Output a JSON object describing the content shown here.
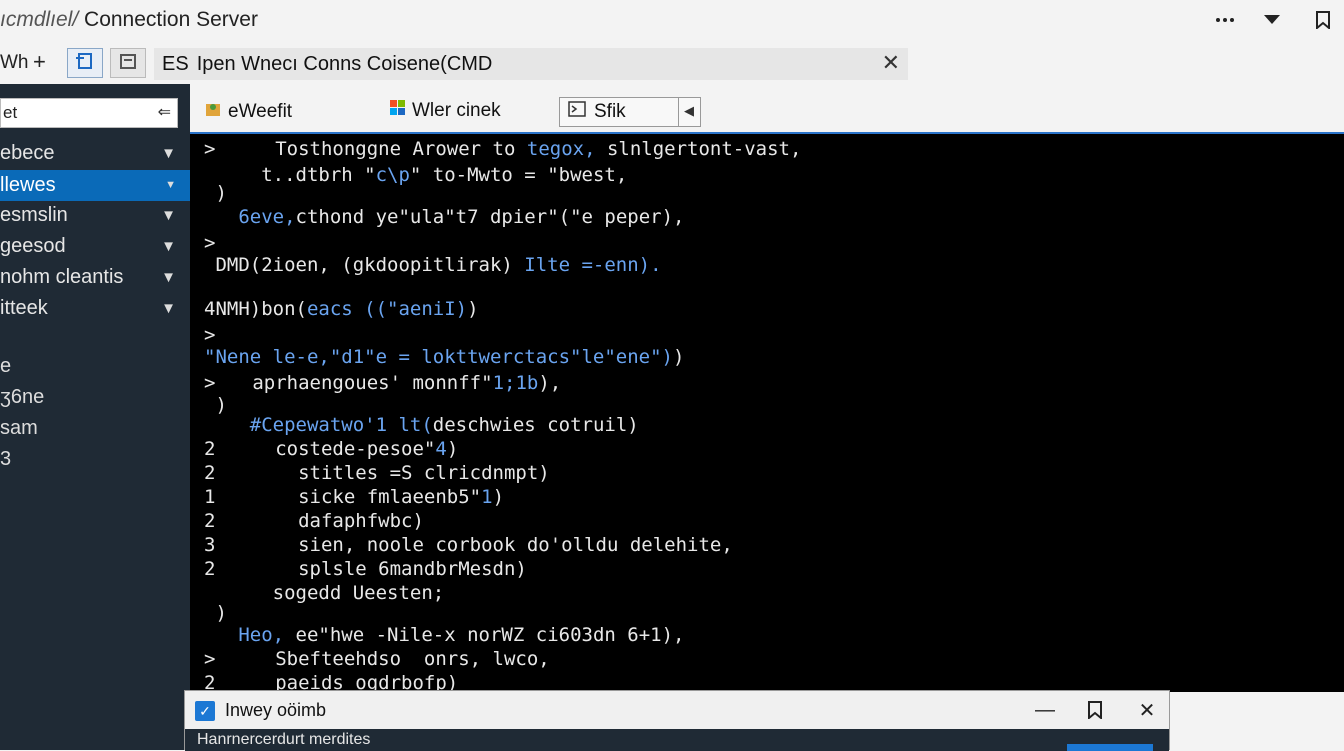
{
  "titlebar": {
    "app": "ıcmdlıel/",
    "title": "Connection Server",
    "more_icon": "more-dots-icon",
    "dropdown_icon": "triangle-down-icon",
    "pin_icon": "bookmark-icon"
  },
  "toolbar": {
    "window_label": "Wh",
    "add_label": "+",
    "address": "Ipen Wnecı  Conns Coisene(CMD",
    "address_prefix": "ES",
    "close_label": "✕"
  },
  "sidebar": {
    "search_value": "et",
    "search_arrow": "⇐",
    "items": [
      {
        "label": "ebece",
        "active": false
      },
      {
        "label": "llewes",
        "active": true
      },
      {
        "label": "esmslin",
        "active": false
      },
      {
        "label": "geesod",
        "active": false
      },
      {
        "label": "nohm cleantis",
        "active": false
      },
      {
        "label": "itteek",
        "active": false
      }
    ],
    "plain": [
      "e",
      "ӡ6ne",
      "sam",
      "3"
    ]
  },
  "inner_tabs": [
    {
      "label": "eWeefit",
      "icon": "package-icon"
    },
    {
      "label": "Wler cinek",
      "icon": "windows-icon"
    },
    {
      "label": "Sfik",
      "icon": "terminal-icon"
    }
  ],
  "terminal": {
    "lines": [
      {
        "prefix": ">",
        "text": "    Tosthonggne Arower to ",
        "blue": "tegox,",
        "rest": " slnlgertont-vast,"
      },
      {
        "prefix": "",
        "text": "     t..dtbrh \"",
        "blue": "c\\p",
        "rest": "\" to-Mwto = \"bwest,"
      },
      {
        "prefix": " )",
        "text": "",
        "blue": "",
        "rest": ""
      },
      {
        "prefix": "",
        "text": "   ",
        "blue": "6eve,",
        "rest": "cthond ye\"ula\"t7 dpier\"(\"e peper),"
      },
      {
        "prefix": ">",
        "text": "",
        "blue": "",
        "rest": ""
      },
      {
        "prefix": "",
        "text": " DMD(2ioen, (gkdoopitlirak) ",
        "blue": "Ilte =-enn).",
        "rest": ""
      },
      {
        "prefix": "",
        "text": "4NMH)bon(",
        "blue": "eacs ((\"aeniI)",
        "rest": ")"
      },
      {
        "prefix": ">",
        "text": "",
        "blue": "",
        "rest": ""
      },
      {
        "prefix": "",
        "text": "",
        "blue": "\"Nene le-e,\"d1\"e = lokttwerctacs\"le\"ene\")",
        "rest": ")"
      },
      {
        "prefix": ">",
        "text": "  aprhaengoues' monnff\"",
        "blue": "1;1b",
        "rest": "),"
      },
      {
        "prefix": " )",
        "text": "",
        "blue": "",
        "rest": ""
      },
      {
        "prefix": "",
        "text": "    ",
        "blue": "#Cepewatwo'1 lt(",
        "rest": "deschwies cotruil)"
      },
      {
        "prefix": "2",
        "text": "    costede-pesoe\"",
        "blue": "4",
        "rest": ")"
      },
      {
        "prefix": "2",
        "text": "      stitles =S clricdnmpt)",
        "blue": "",
        "rest": ""
      },
      {
        "prefix": "1",
        "text": "      sicke fmlaeenb5\"",
        "blue": "1",
        "rest": ")"
      },
      {
        "prefix": "2",
        "text": "      dafaphfwbc)",
        "blue": "",
        "rest": ""
      },
      {
        "prefix": "3",
        "text": "      sien, noole corbook do'olldu delehite,",
        "blue": "",
        "rest": ""
      },
      {
        "prefix": "2",
        "text": "      splsle 6mandbrMesdn)",
        "blue": "",
        "rest": ""
      },
      {
        "prefix": "",
        "text": "      sogedd Ueesten;",
        "blue": "",
        "rest": ""
      },
      {
        "prefix": " )",
        "text": "",
        "blue": "",
        "rest": ""
      },
      {
        "prefix": "",
        "text": "   ",
        "blue": "Heo,",
        "rest": " ee\"hwe -Nile-x norWZ ci603dn 6+1),"
      },
      {
        "prefix": ">",
        "text": "    Sbefteehdso  onrs, lwco,",
        "blue": "",
        "rest": ""
      },
      {
        "prefix": "2",
        "text": "    paeids ogdrbofp)",
        "blue": "",
        "rest": ""
      }
    ]
  },
  "popup": {
    "title": "Inwey oöimb",
    "body": "Hanrnercerdurt merdites",
    "minimize": "—",
    "pin": "bookmark-icon",
    "close": "✕"
  }
}
